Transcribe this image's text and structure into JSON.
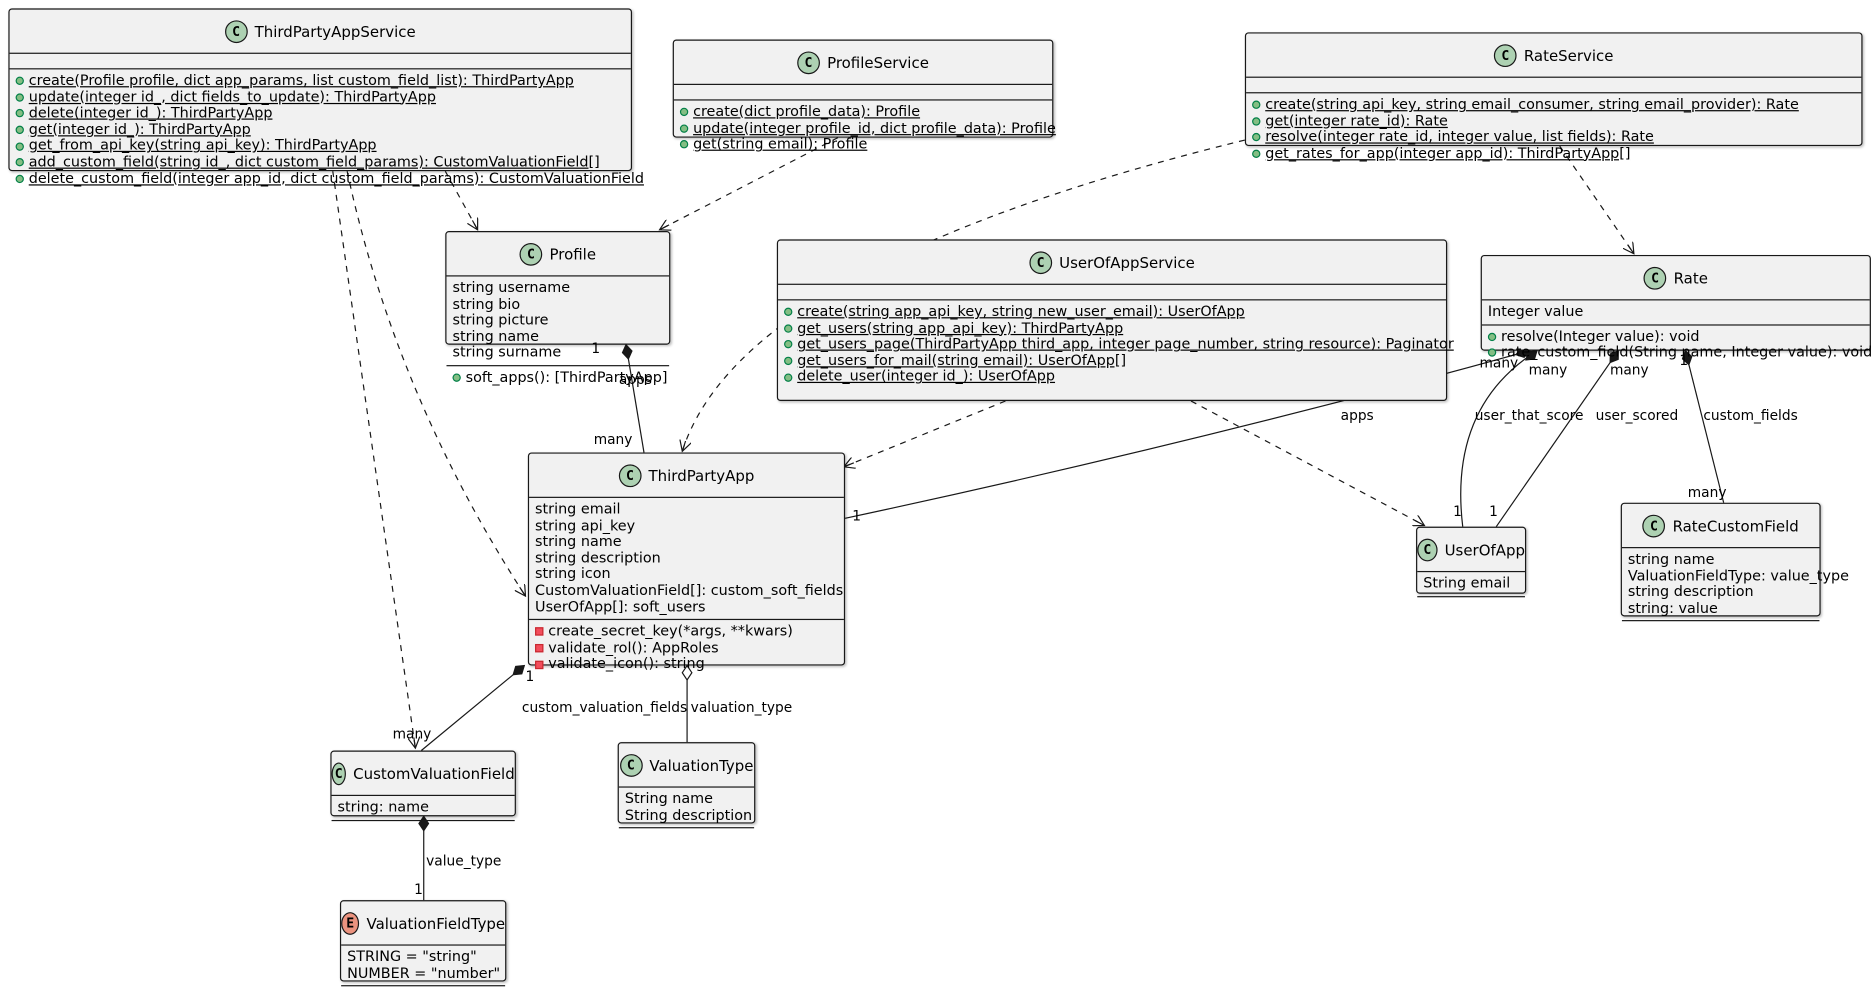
{
  "colors": {
    "class_icon": "#add1b2",
    "enum_icon": "#eb937f",
    "box_fill": "#f1f1f1",
    "line": "#181818"
  },
  "classes": {
    "ThirdPartyAppService": {
      "name": "ThirdPartyAppService",
      "kind": "C",
      "attributes": [],
      "methods": [
        {
          "vis": "+",
          "static": true,
          "text": "create(Profile profile, dict app_params, list custom_field_list): ThirdPartyApp"
        },
        {
          "vis": "+",
          "static": true,
          "text": "update(integer id_, dict fields_to_update): ThirdPartyApp"
        },
        {
          "vis": "+",
          "static": true,
          "text": "delete(integer id_): ThirdPartyApp"
        },
        {
          "vis": "+",
          "static": true,
          "text": "get(integer id_): ThirdPartyApp"
        },
        {
          "vis": "+",
          "static": true,
          "text": "get_from_api_key(string api_key): ThirdPartyApp"
        },
        {
          "vis": "+",
          "static": true,
          "text": "add_custom_field(string id_, dict custom_field_params): CustomValuationField[]"
        },
        {
          "vis": "+",
          "static": true,
          "text": "delete_custom_field(integer app_id, dict custom_field_params): CustomValuationField"
        }
      ]
    },
    "ProfileService": {
      "name": "ProfileService",
      "kind": "C",
      "attributes": [],
      "methods": [
        {
          "vis": "+",
          "static": true,
          "text": "create(dict profile_data): Profile"
        },
        {
          "vis": "+",
          "static": true,
          "text": "update(integer profile_id, dict profile_data): Profile"
        },
        {
          "vis": "+",
          "static": true,
          "text": "get(string email): Profile"
        }
      ]
    },
    "RateService": {
      "name": "RateService",
      "kind": "C",
      "attributes": [],
      "methods": [
        {
          "vis": "+",
          "static": true,
          "text": "create(string api_key, string email_consumer, string email_provider): Rate"
        },
        {
          "vis": "+",
          "static": true,
          "text": "get(integer rate_id): Rate"
        },
        {
          "vis": "+",
          "static": true,
          "text": "resolve(integer rate_id, integer value, list fields): Rate"
        },
        {
          "vis": "+",
          "static": true,
          "text": "get_rates_for_app(integer app_id): ThirdPartyApp[]"
        }
      ]
    },
    "Profile": {
      "name": "Profile",
      "kind": "C",
      "attributes": [
        "string username",
        "string bio",
        "string picture",
        "string name",
        "string surname"
      ],
      "methods": [
        {
          "vis": "+",
          "static": false,
          "text": "soft_apps(): [ThirdPartyApp]"
        }
      ]
    },
    "UserOfAppService": {
      "name": "UserOfAppService",
      "kind": "C",
      "attributes": [],
      "methods": [
        {
          "vis": "+",
          "static": true,
          "text": "create(string app_api_key, string new_user_email): UserOfApp"
        },
        {
          "vis": "+",
          "static": true,
          "text": "get_users(string app_api_key): ThirdPartyApp"
        },
        {
          "vis": "+",
          "static": true,
          "text": "get_users_page(ThirdPartyApp third_app, integer page_number, string resource): Paginator"
        },
        {
          "vis": "+",
          "static": true,
          "text": "get_users_for_mail(string email): UserOfApp[]"
        },
        {
          "vis": "+",
          "static": true,
          "text": "delete_user(integer id_): UserOfApp"
        }
      ]
    },
    "Rate": {
      "name": "Rate",
      "kind": "C",
      "attributes": [
        "Integer value"
      ],
      "methods": [
        {
          "vis": "+",
          "static": false,
          "text": "resolve(Integer value): void"
        },
        {
          "vis": "+",
          "static": false,
          "text": "rate_custom_field(String name, Integer value): void"
        }
      ]
    },
    "ThirdPartyApp": {
      "name": "ThirdPartyApp",
      "kind": "C",
      "attributes": [
        "string email",
        "string api_key",
        "string name",
        "string description",
        "string icon",
        "CustomValuationField[]: custom_soft_fields",
        "UserOfApp[]: soft_users"
      ],
      "methods": [
        {
          "vis": "-",
          "static": false,
          "text": "create_secret_key(*args, **kwars)"
        },
        {
          "vis": "-",
          "static": false,
          "text": "validate_rol(): AppRoles"
        },
        {
          "vis": "-",
          "static": false,
          "text": "validate_icon(): string"
        }
      ]
    },
    "UserOfApp": {
      "name": "UserOfApp",
      "kind": "C",
      "attributes": [
        "String email"
      ],
      "methods": []
    },
    "RateCustomField": {
      "name": "RateCustomField",
      "kind": "C",
      "attributes": [
        "string name",
        "ValuationFieldType: value_type",
        "string description",
        "string: value"
      ],
      "methods": []
    },
    "CustomValuationField": {
      "name": "CustomValuationField",
      "kind": "C",
      "attributes": [
        "string: name"
      ],
      "methods": []
    },
    "ValuationType": {
      "name": "ValuationType",
      "kind": "C",
      "attributes": [
        "String name",
        "String description"
      ],
      "methods": []
    },
    "ValuationFieldType": {
      "name": "ValuationFieldType",
      "kind": "E",
      "attributes": [
        "STRING = \"string\"",
        "NUMBER = \"number\""
      ],
      "methods": []
    }
  },
  "relations": [
    {
      "from": "ThirdPartyAppService",
      "to": "CustomValuationField",
      "type": "dependency"
    },
    {
      "from": "ThirdPartyAppService",
      "to": "ThirdPartyApp",
      "type": "dependency"
    },
    {
      "from": "ThirdPartyAppService",
      "to": "Profile",
      "type": "dependency"
    },
    {
      "from": "ProfileService",
      "to": "Profile",
      "type": "dependency"
    },
    {
      "from": "RateService",
      "to": "ThirdPartyApp",
      "type": "dependency"
    },
    {
      "from": "RateService",
      "to": "Rate",
      "type": "dependency"
    },
    {
      "from": "UserOfAppService",
      "to": "ThirdPartyApp",
      "type": "dependency"
    },
    {
      "from": "UserOfAppService",
      "to": "UserOfApp",
      "type": "dependency"
    },
    {
      "from": "Profile",
      "to": "ThirdPartyApp",
      "type": "composition",
      "label": "apps",
      "from_mult": "1",
      "to_mult": "many"
    },
    {
      "from": "Rate",
      "to": "ThirdPartyApp",
      "type": "composition",
      "label": "apps",
      "from_mult": "many",
      "to_mult": "1"
    },
    {
      "from": "Rate",
      "to": "UserOfApp",
      "type": "composition",
      "label": "user_that_score",
      "from_mult": "many",
      "to_mult": "1"
    },
    {
      "from": "Rate",
      "to": "UserOfApp",
      "type": "composition",
      "label": "user_scored",
      "from_mult": "many",
      "to_mult": "1"
    },
    {
      "from": "Rate",
      "to": "RateCustomField",
      "type": "composition",
      "label": "custom_fields",
      "from_mult": "1",
      "to_mult": "many"
    },
    {
      "from": "ThirdPartyApp",
      "to": "CustomValuationField",
      "type": "composition",
      "label": "custom_valuation_fields",
      "from_mult": "1",
      "to_mult": "many"
    },
    {
      "from": "ThirdPartyApp",
      "to": "ValuationType",
      "type": "aggregation",
      "label": "valuation_type"
    },
    {
      "from": "CustomValuationField",
      "to": "ValuationFieldType",
      "type": "composition",
      "label": "value_type",
      "to_mult": "1"
    }
  ]
}
